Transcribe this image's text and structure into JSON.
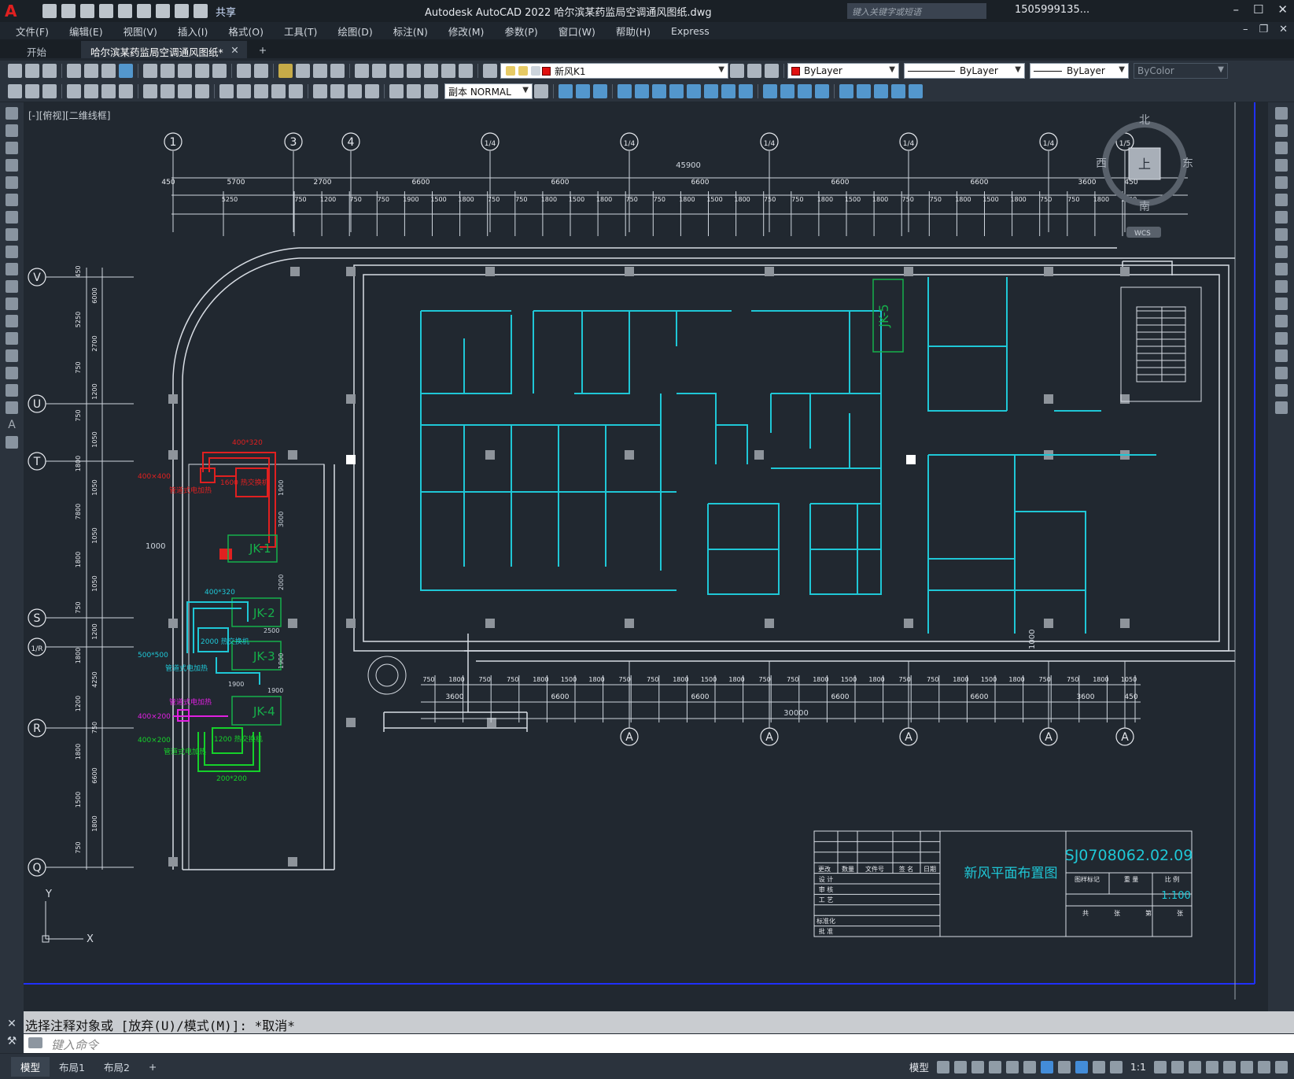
{
  "titlebar": {
    "app_title": "Autodesk AutoCAD 2022    哈尔滨某药监局空调通风图纸.dwg",
    "share_label": "共享",
    "search_placeholder": "键入关键字或短语",
    "user_name": "1505999135..."
  },
  "menu": [
    "文件(F)",
    "编辑(E)",
    "视图(V)",
    "插入(I)",
    "格式(O)",
    "工具(T)",
    "绘图(D)",
    "标注(N)",
    "修改(M)",
    "参数(P)",
    "窗口(W)",
    "帮助(H)",
    "Express"
  ],
  "tabs": {
    "start": "开始",
    "active": "哈尔滨某药监局空调通风图纸*"
  },
  "toolbar": {
    "layer": "新风K1",
    "color": "ByLayer",
    "linetype": "ByLayer",
    "lineweight": "ByLayer",
    "plotstyle": "ByColor",
    "textstyle": "副本 NORMAL",
    "layer_color": "#e01010"
  },
  "view_label": "[-][俯视][二维线框]",
  "viewcube": {
    "north": "北",
    "south": "南",
    "east": "东",
    "west": "西",
    "top": "上",
    "wcs": "WCS"
  },
  "drawing": {
    "grid_top": [
      "1",
      "3",
      "4",
      "1/4",
      "1/4",
      "1/4",
      "1/4",
      "1/4",
      "1/5"
    ],
    "grid_left": [
      "V",
      "U",
      "T",
      "S",
      "1/R",
      "R",
      "Q"
    ],
    "grid_bottom": [
      "A",
      "A",
      "A",
      "A",
      "A"
    ],
    "overall_dim_top": "45900",
    "dims_top_row1": [
      "450",
      "5700",
      "2700",
      "6600",
      "6600",
      "6600",
      "6600",
      "6600",
      "3600",
      "450"
    ],
    "dims_top_row2": [
      "5250",
      "750",
      "1200",
      "750",
      "750",
      "1900",
      "1500",
      "1800",
      "750",
      "750",
      "1800",
      "1500",
      "1800",
      "750",
      "750",
      "1800",
      "1500",
      "1800",
      "750",
      "750",
      "1800",
      "1500",
      "1800",
      "750",
      "750",
      "1800",
      "1500",
      "1800",
      "750",
      "750",
      "1800",
      "1050"
    ],
    "dims_bottom_row1": [
      "750",
      "1800",
      "750",
      "750",
      "1800",
      "1500",
      "1800",
      "750",
      "750",
      "1800",
      "1500",
      "1800",
      "750",
      "750",
      "1800",
      "1500",
      "1800",
      "750",
      "750",
      "1800",
      "1500",
      "1800",
      "750",
      "750",
      "1800",
      "1050"
    ],
    "dims_bottom_row2": [
      "3600",
      "6600",
      "6600",
      "6600",
      "6600",
      "3600",
      "450"
    ],
    "overall_dim_bottom": "30000",
    "dims_left": [
      "450",
      "6000",
      "5250",
      "2700",
      "750",
      "1200",
      "750",
      "1050",
      "1800",
      "1050",
      "7800",
      "1050",
      "1800",
      "1050",
      "750",
      "1200",
      "1800",
      "4250",
      "1200",
      "750",
      "1800",
      "6600",
      "1500",
      "1800",
      "750"
    ],
    "dim_1000": "1000",
    "dim_1000b": "1000",
    "units": [
      "JK-1",
      "JK-2",
      "JK-3",
      "JK-4",
      "JK-5"
    ],
    "duct_labels": [
      "400*320",
      "400×400",
      "管道式电加热",
      "1600 热交换机",
      "400*320",
      "2000 热交换机",
      "500*500",
      "管道式电加热",
      "管道式电加热",
      "400×200",
      "400×200",
      "1200 热交换机",
      "管道式电加热",
      "200*200",
      "2500",
      "1900",
      "1900",
      "3000",
      "2000",
      "1900",
      "1900"
    ],
    "title_block": {
      "drawing_no": "SJ0708062.02.09",
      "title": "新风平面布置图",
      "scale_label": "比 例",
      "scale": "1:100",
      "rows": [
        "设 计",
        "审 核",
        "工 艺",
        "标准化",
        "批 准"
      ],
      "header": [
        "更改",
        "数量",
        "文件号",
        "签 名",
        "日期"
      ],
      "mid_header": [
        "图样标记",
        "重 量",
        "比 例"
      ],
      "bottom_header": [
        "共",
        "张",
        "第",
        "张"
      ]
    },
    "ucs": {
      "x": "X",
      "y": "Y"
    }
  },
  "command": {
    "history": "选择注释对象或 [放弃(U)/模式(M)]: *取消*",
    "placeholder": "键入命令"
  },
  "status": {
    "layouts": [
      "模型",
      "布局1",
      "布局2"
    ],
    "model_label": "模型",
    "scale": "1:1"
  }
}
